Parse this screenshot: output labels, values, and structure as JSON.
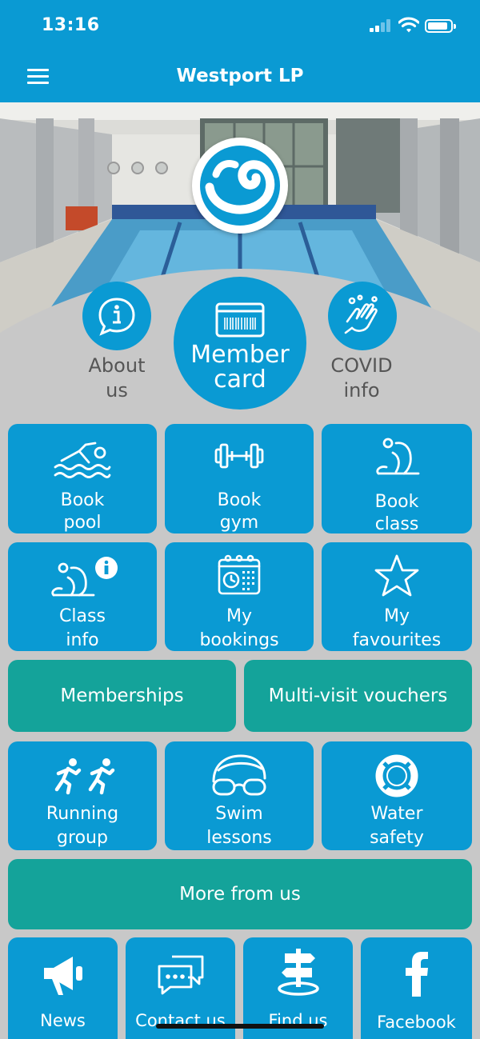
{
  "status": {
    "time": "13:16"
  },
  "nav": {
    "title": "Westport LP",
    "menu_icon": "hamburger-menu-icon"
  },
  "hero": {
    "logo_icon": "w-wave-logo"
  },
  "quick_links": {
    "about": {
      "label": "About\nus",
      "icon": "info-speech-icon"
    },
    "member_card": {
      "label": "Member\ncard",
      "icon": "barcode-card-icon"
    },
    "covid": {
      "label": "COVID\ninfo",
      "icon": "hand-wash-icon"
    }
  },
  "tiles": [
    {
      "label": "Book\npool",
      "icon": "swimmer-icon"
    },
    {
      "label": "Book\ngym",
      "icon": "dumbbell-icon"
    },
    {
      "label": "Book\nclass",
      "icon": "yoga-pose-icon"
    },
    {
      "label": "Class\ninfo",
      "icon": "yoga-info-icon"
    },
    {
      "label": "My\nbookings",
      "icon": "calendar-clock-icon"
    },
    {
      "label": "My\nfavourites",
      "icon": "star-icon"
    }
  ],
  "wide_buttons": {
    "memberships": "Memberships",
    "vouchers": "Multi-visit vouchers",
    "more": "More from us"
  },
  "activity_tiles": [
    {
      "label": "Running\ngroup",
      "icon": "runners-icon"
    },
    {
      "label": "Swim\nlessons",
      "icon": "swim-goggles-icon"
    },
    {
      "label": "Water\nsafety",
      "icon": "life-ring-icon"
    }
  ],
  "bottom_tiles": [
    {
      "label": "News",
      "icon": "megaphone-icon"
    },
    {
      "label": "Contact us",
      "icon": "chat-bubbles-icon"
    },
    {
      "label": "Find us",
      "icon": "signpost-icon"
    },
    {
      "label": "Facebook",
      "icon": "facebook-icon"
    }
  ],
  "colors": {
    "brand_blue": "#0a9ad3",
    "teal": "#14a39a",
    "background": "#c8c8c8",
    "label_grey": "#555555"
  }
}
